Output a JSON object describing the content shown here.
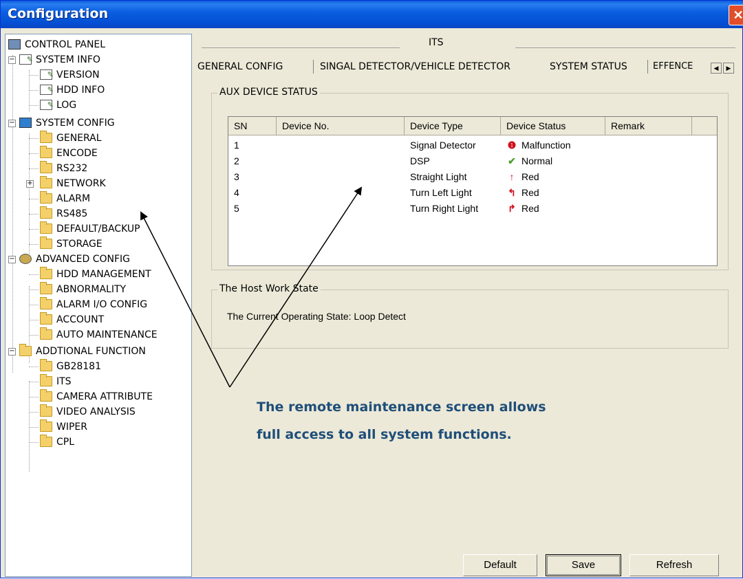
{
  "window": {
    "title": "Configuration",
    "close_label": "✕"
  },
  "tree": {
    "root": "CONTROL PANEL",
    "system_info": {
      "label": "SYSTEM INFO",
      "children": [
        "VERSION",
        "HDD INFO",
        "LOG"
      ]
    },
    "system_config": {
      "label": "SYSTEM CONFIG",
      "children": [
        "GENERAL",
        "ENCODE",
        "RS232",
        "NETWORK",
        "ALARM",
        "RS485",
        "DEFAULT/BACKUP",
        "STORAGE"
      ]
    },
    "advanced_config": {
      "label": "ADVANCED CONFIG",
      "children": [
        "HDD MANAGEMENT",
        "ABNORMALITY",
        "ALARM I/O CONFIG",
        "ACCOUNT",
        "AUTO MAINTENANCE"
      ]
    },
    "additional_function": {
      "label": "ADDTIONAL FUNCTION",
      "children": [
        "GB28181",
        "ITS",
        "CAMERA ATTRIBUTE",
        "VIDEO ANALYSIS",
        "WIPER",
        "CPL"
      ]
    }
  },
  "section_title": "ITS",
  "tabs": [
    "GENERAL CONFIG",
    "SINGAL DETECTOR/VEHICLE DETECTOR",
    "SYSTEM STATUS",
    "EFFENCE"
  ],
  "aux_group": {
    "title": "AUX DEVICE STATUS"
  },
  "table": {
    "columns": [
      "SN",
      "Device No.",
      "Device Type",
      "Device Status",
      "Remark"
    ],
    "rows": [
      {
        "sn": "1",
        "device_no": "",
        "type": "Signal Detector",
        "status": "Malfunction",
        "status_icon": "error-icon",
        "color": "#d0101c"
      },
      {
        "sn": "2",
        "device_no": "",
        "type": "DSP",
        "status": "Normal",
        "status_icon": "check-icon",
        "color": "#4aa02c"
      },
      {
        "sn": "3",
        "device_no": "",
        "type": "Straight Light",
        "status": "Red",
        "status_icon": "arrow-up-icon",
        "color": "#d0101c"
      },
      {
        "sn": "4",
        "device_no": "",
        "type": "Turn Left Light",
        "status": "Red",
        "status_icon": "turn-left-icon",
        "color": "#d0101c"
      },
      {
        "sn": "5",
        "device_no": "",
        "type": "Turn Right Light",
        "status": "Red",
        "status_icon": "turn-right-icon",
        "color": "#d0101c"
      }
    ]
  },
  "host_group": {
    "title": "The Host Work State",
    "text": "The Current Operating State: Loop Detect"
  },
  "buttons": {
    "default": "Default",
    "save": "Save",
    "refresh": "Refresh"
  },
  "annotation": {
    "line1": "The remote maintenance screen allows",
    "line2": "full access to all system functions."
  }
}
